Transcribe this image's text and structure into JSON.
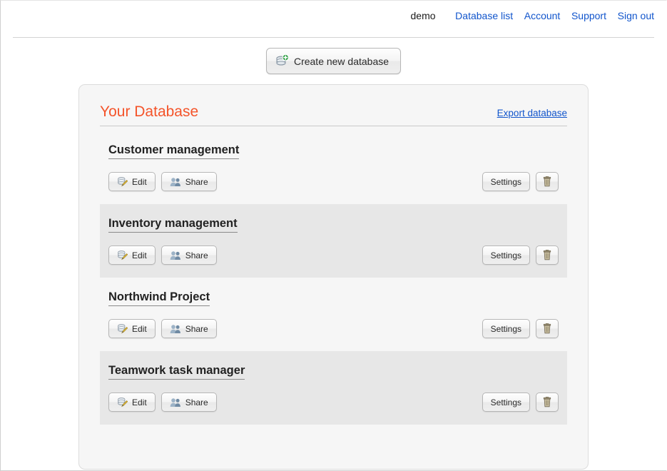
{
  "topnav": {
    "user": "demo",
    "links": [
      {
        "label": "Database list",
        "name": "nav-link-database-list"
      },
      {
        "label": "Account",
        "name": "nav-link-account"
      },
      {
        "label": "Support",
        "name": "nav-link-support"
      },
      {
        "label": "Sign out",
        "name": "nav-link-sign-out"
      }
    ]
  },
  "toolbar": {
    "create_label": "Create new database",
    "create_icon": "database-add-icon"
  },
  "panel": {
    "title": "Your Database",
    "title_color": "#f4542a",
    "export_label": "Export database",
    "link_color": "#1155cc",
    "shaded_row_color": "#e7e7e7",
    "row_actions": {
      "edit_label": "Edit",
      "edit_icon": "database-edit-icon",
      "share_label": "Share",
      "share_icon": "users-icon",
      "settings_label": "Settings",
      "delete_icon": "trash-icon"
    },
    "databases": [
      {
        "name": "Customer management",
        "shaded": false
      },
      {
        "name": "Inventory management",
        "shaded": true
      },
      {
        "name": "Northwind Project",
        "shaded": false
      },
      {
        "name": "Teamwork task manager",
        "shaded": true
      }
    ]
  }
}
